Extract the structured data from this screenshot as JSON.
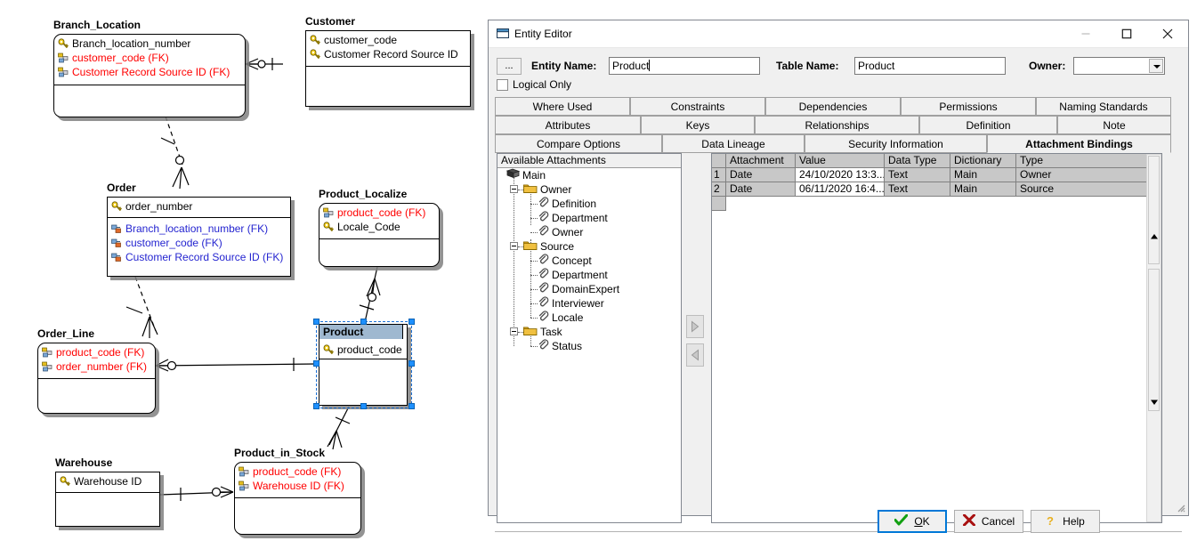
{
  "diagram": {
    "entities": [
      {
        "name": "Branch_Location",
        "style": "rounded",
        "attrs_key": [
          {
            "text": "Branch_location_number",
            "kind": "pk"
          },
          {
            "text": "customer_code (FK)",
            "kind": "fkred"
          },
          {
            "text": "Customer Record Source ID (FK)",
            "kind": "fkred"
          }
        ],
        "attrs_nonkey": []
      },
      {
        "name": "Customer",
        "style": "square",
        "attrs_key": [
          {
            "text": "customer_code",
            "kind": "pk"
          },
          {
            "text": "Customer Record Source ID",
            "kind": "pk"
          }
        ],
        "attrs_nonkey": []
      },
      {
        "name": "Order",
        "style": "square",
        "attrs_key": [
          {
            "text": "order_number",
            "kind": "pk"
          }
        ],
        "attrs_nonkey": [
          {
            "text": "Branch_location_number (FK)",
            "kind": "fkblue"
          },
          {
            "text": "customer_code (FK)",
            "kind": "fkblue"
          },
          {
            "text": "Customer Record Source ID (FK)",
            "kind": "fkblue"
          }
        ]
      },
      {
        "name": "Product_Localize",
        "style": "rounded",
        "attrs_key": [
          {
            "text": "product_code (FK)",
            "kind": "fkred"
          },
          {
            "text": "Locale_Code",
            "kind": "pk"
          }
        ],
        "attrs_nonkey": []
      },
      {
        "name": "Order_Line",
        "style": "rounded",
        "attrs_key": [
          {
            "text": "product_code (FK)",
            "kind": "fkred"
          },
          {
            "text": "order_number (FK)",
            "kind": "fkred"
          }
        ],
        "attrs_nonkey": []
      },
      {
        "name": "Product",
        "style": "square",
        "selected": true,
        "attrs_key": [
          {
            "text": "product_code",
            "kind": "pk"
          }
        ],
        "attrs_nonkey": []
      },
      {
        "name": "Warehouse",
        "style": "square",
        "attrs_key": [
          {
            "text": "Warehouse ID",
            "kind": "pk"
          }
        ],
        "attrs_nonkey": []
      },
      {
        "name": "Product_in_Stock",
        "style": "rounded",
        "attrs_key": [
          {
            "text": "product_code (FK)",
            "kind": "fkred"
          },
          {
            "text": "Warehouse ID (FK)",
            "kind": "fkred"
          }
        ],
        "attrs_nonkey": []
      }
    ]
  },
  "dialog": {
    "title": "Entity Editor",
    "window_icon": "entity-editor-icon",
    "minimize_label": "minimize-icon",
    "maximize_label": "maximize-icon",
    "close_label": "close-icon",
    "browse_button_label": "...",
    "entity_name_label": "Entity Name:",
    "entity_name_value": "Product",
    "table_name_label": "Table Name:",
    "table_name_value": "Product",
    "owner_label": "Owner:",
    "owner_value": "",
    "logical_only_label": "Logical Only",
    "logical_only_checked": false,
    "tabs_row1": [
      "Where Used",
      "Constraints",
      "Dependencies",
      "Permissions",
      "Naming Standards"
    ],
    "tabs_row2": [
      "Attributes",
      "Keys",
      "Relationships",
      "Definition",
      "Note"
    ],
    "tabs_row3": [
      "Compare Options",
      "Data Lineage",
      "Security Information",
      "Attachment Bindings"
    ],
    "active_tab": "Attachment Bindings",
    "available_attachments_header": "Available Attachments",
    "tree": [
      {
        "label": "Main",
        "depth": 0,
        "icon": "book-icon",
        "expander": false
      },
      {
        "label": "Owner",
        "depth": 1,
        "icon": "folder-icon",
        "expander": true
      },
      {
        "label": "Definition",
        "depth": 2,
        "icon": "paperclip-icon",
        "expander": false
      },
      {
        "label": "Department",
        "depth": 2,
        "icon": "paperclip-icon",
        "expander": false
      },
      {
        "label": "Owner",
        "depth": 2,
        "icon": "paperclip-icon",
        "expander": false
      },
      {
        "label": "Source",
        "depth": 1,
        "icon": "folder-icon",
        "expander": true
      },
      {
        "label": "Concept",
        "depth": 2,
        "icon": "paperclip-icon",
        "expander": false
      },
      {
        "label": "Department",
        "depth": 2,
        "icon": "paperclip-icon",
        "expander": false
      },
      {
        "label": "DomainExpert",
        "depth": 2,
        "icon": "paperclip-icon",
        "expander": false
      },
      {
        "label": "Interviewer",
        "depth": 2,
        "icon": "paperclip-icon",
        "expander": false
      },
      {
        "label": "Locale",
        "depth": 2,
        "icon": "paperclip-icon",
        "expander": false
      },
      {
        "label": "Task",
        "depth": 1,
        "icon": "folder-icon",
        "expander": true
      },
      {
        "label": "Status",
        "depth": 2,
        "icon": "paperclip-icon",
        "expander": false
      }
    ],
    "grid": {
      "columns": [
        "Attachment",
        "Value",
        "Data Type",
        "Dictionary",
        "Type"
      ],
      "rows": [
        {
          "num": "1",
          "Attachment": "Date",
          "Value": "24/10/2020 13:3...",
          "Data Type": "Text",
          "Dictionary": "Main",
          "Type": "Owner"
        },
        {
          "num": "2",
          "Attachment": "Date",
          "Value": "06/11/2020 16:4...",
          "Data Type": "Text",
          "Dictionary": "Main",
          "Type": "Source"
        }
      ]
    },
    "transfer_add_label": "add-attachment-arrow",
    "transfer_remove_label": "remove-attachment-arrow",
    "buttons": {
      "ok": "OK",
      "ok_mnemonic": "O",
      "ok_rest": "K",
      "cancel": "Cancel",
      "help": "Help"
    },
    "colors": {
      "selection": "#1e90ff",
      "selected_title_bg": "#9fb8d0",
      "fk_red": "#ff0000",
      "fk_blue": "#2424d0",
      "focus_border": "#0078d7",
      "grid_header": "#c8c8c8"
    }
  }
}
